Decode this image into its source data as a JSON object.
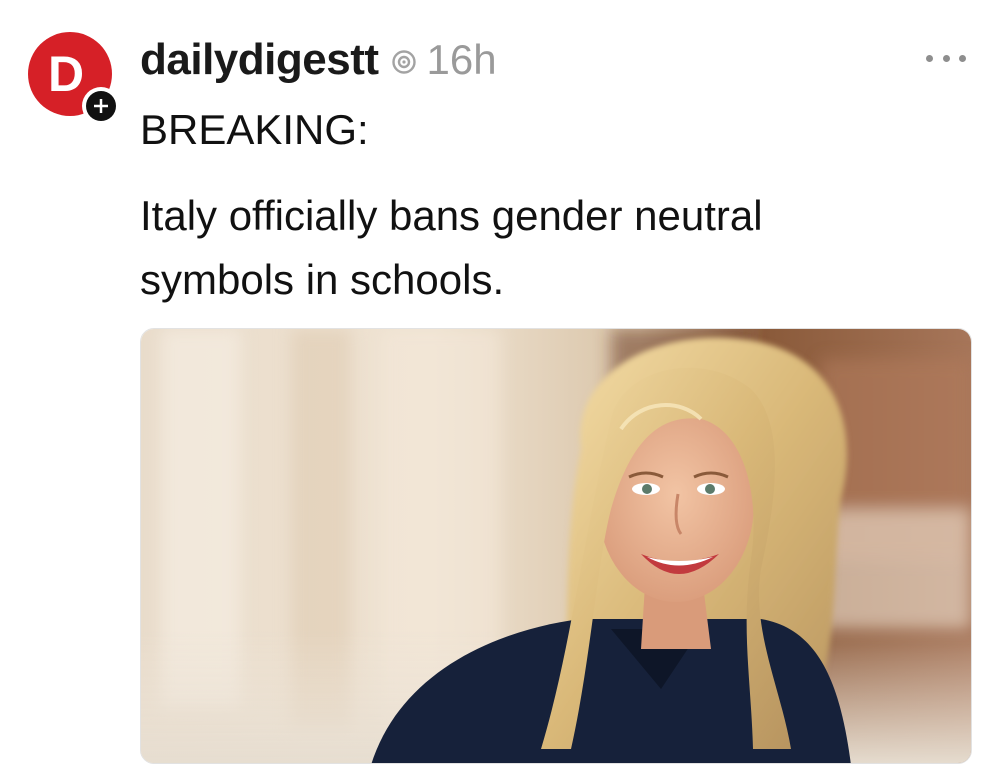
{
  "post": {
    "avatar": {
      "letter": "D",
      "color": "#d62027",
      "badge_icon": "plus-icon"
    },
    "username": "dailydigestt",
    "status_icon": "threads-activity-icon",
    "time": "16h",
    "more_icon": "more-horizontal-icon",
    "text_lines": [
      "BREAKING:",
      "Italy officially bans gender neutral",
      "symbols in schools."
    ],
    "image": {
      "alt": "photo"
    }
  },
  "colors": {
    "brand": "#d62027",
    "text": "#111111",
    "muted": "#9a9a9a"
  }
}
